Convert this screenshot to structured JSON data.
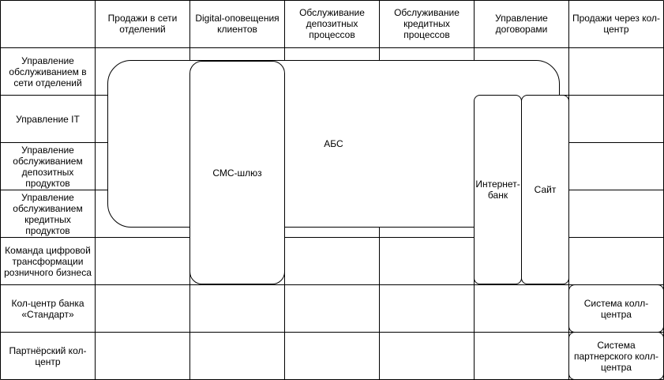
{
  "columns": [
    "Продажи в сети отделений",
    "Digital-оповещения клиентов",
    "Обслуживание депозитных процессов",
    "Обслуживание кредитных процессов",
    "Управление договорами",
    "Продажи через кол-центр"
  ],
  "rows": [
    "Управление обслуживанием в сети отделений",
    "Управление IT",
    "Управление обслуживанием депозитных продуктов",
    "Управление обслуживанием кредитных продуктов",
    "Команда цифровой трансформации розничного бизнеса",
    "Кол-центр банка «Стандарт»",
    "Партнёрский кол-центр"
  ],
  "systems": {
    "abs": "АБС",
    "sms_gateway": "СМС-шлюз",
    "internet_bank": "Интернет-банк",
    "site": "Сайт",
    "call_center_system": "Система колл-центра",
    "partner_call_center_system": "Система партнерского колл-центра"
  }
}
